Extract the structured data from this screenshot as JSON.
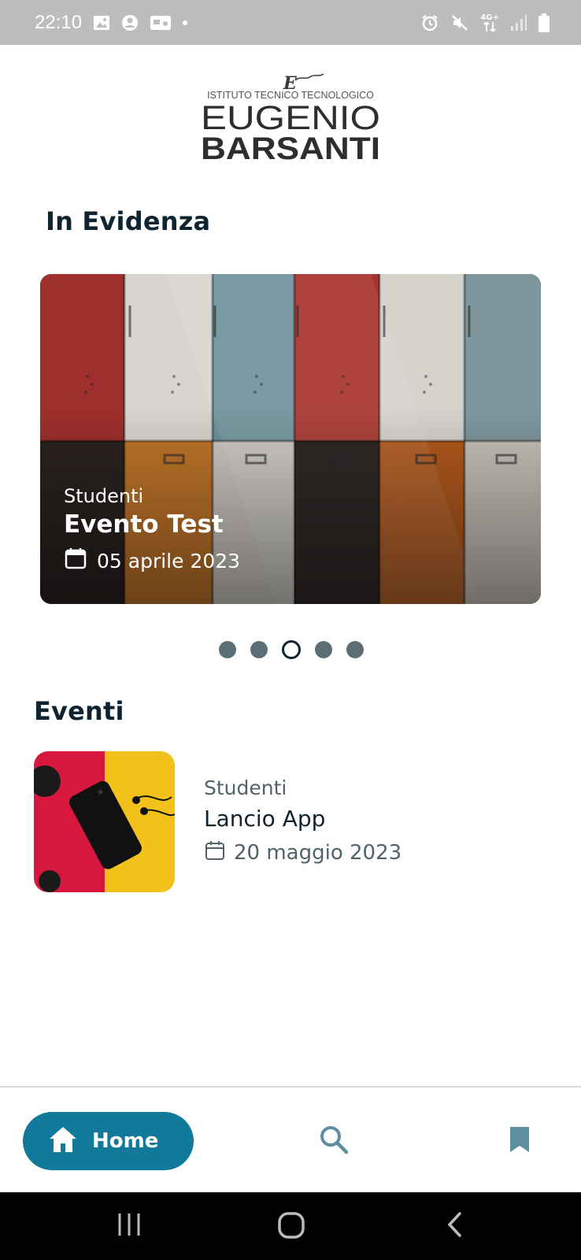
{
  "status_bar": {
    "time": "22:10",
    "network_label": "4G+"
  },
  "logo": {
    "monogram": "E",
    "subtitle": "ISTITUTO TECNICO TECNOLOGICO",
    "line1": "EUGENIO",
    "line2": "BARSANTI"
  },
  "featured": {
    "section_title": "In Evidenza",
    "category": "Studenti",
    "title": "Evento Test",
    "date": "05 aprile 2023",
    "dot_count": 5,
    "active_dot": 2
  },
  "events": {
    "section_title": "Eventi",
    "items": [
      {
        "category": "Studenti",
        "title": "Lancio App",
        "date": "20 maggio 2023"
      }
    ]
  },
  "bottom_nav": {
    "home_label": "Home",
    "accent_color": "#117a9b",
    "icons": [
      "home-icon",
      "search-icon",
      "bookmark-icon"
    ]
  },
  "colors": {
    "text_primary": "#0f2430",
    "text_secondary": "#51636a",
    "dot_inactive": "#5c6e75"
  }
}
